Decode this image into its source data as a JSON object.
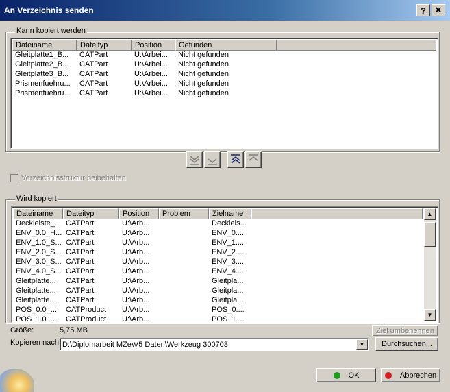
{
  "window": {
    "title": "An Verzeichnis senden",
    "help_label": "?",
    "close_label": "✕"
  },
  "copyable": {
    "legend": "Kann kopiert werden",
    "columns": [
      "Dateiname",
      "Dateityp",
      "Position",
      "Gefunden"
    ],
    "rows": [
      [
        "Gleitplatte1_B...",
        "CATPart",
        "U:\\Arbei...",
        "Nicht gefunden"
      ],
      [
        "Gleitplatte2_B...",
        "CATPart",
        "U:\\Arbei...",
        "Nicht gefunden"
      ],
      [
        "Gleitplatte3_B...",
        "CATPart",
        "U:\\Arbei...",
        "Nicht gefunden"
      ],
      [
        "Prismenfuehru...",
        "CATPart",
        "U:\\Arbei...",
        "Nicht gefunden"
      ],
      [
        "Prismenfuehru...",
        "CATPart",
        "U:\\Arbei...",
        "Nicht gefunden"
      ]
    ]
  },
  "transfer_buttons": [
    "move-all-down-icon",
    "move-down-icon",
    "move-all-up-icon",
    "move-up-icon"
  ],
  "keep_structure": {
    "label": "Verzeichnisstruktur beibehalten",
    "checked": false
  },
  "copied": {
    "legend": "Wird kopiert",
    "columns": [
      "Dateiname",
      "Dateityp",
      "Position",
      "Problem",
      "Zielname"
    ],
    "rows": [
      [
        "Deckleiste_...",
        "CATPart",
        "U:\\Arb...",
        "",
        "Deckleis..."
      ],
      [
        "ENV_0.0_H...",
        "CATPart",
        "U:\\Arb...",
        "",
        "ENV_0...."
      ],
      [
        "ENV_1.0_S...",
        "CATPart",
        "U:\\Arb...",
        "",
        "ENV_1...."
      ],
      [
        "ENV_2.0_S...",
        "CATPart",
        "U:\\Arb...",
        "",
        "ENV_2...."
      ],
      [
        "ENV_3.0_S...",
        "CATPart",
        "U:\\Arb...",
        "",
        "ENV_3...."
      ],
      [
        "ENV_4.0_S...",
        "CATPart",
        "U:\\Arb...",
        "",
        "ENV_4...."
      ],
      [
        "Gleitplatte...",
        "CATPart",
        "U:\\Arb...",
        "",
        "Gleitpla..."
      ],
      [
        "Gleitplatte...",
        "CATPart",
        "U:\\Arb...",
        "",
        "Gleitpla..."
      ],
      [
        "Gleitplatte...",
        "CATPart",
        "U:\\Arb...",
        "",
        "Gleitpla..."
      ],
      [
        "POS_0.0_...",
        "CATProduct",
        "U:\\Arb...",
        "",
        "POS_0...."
      ],
      [
        "POS_1.0_...",
        "CATProduct",
        "U:\\Arb...",
        "",
        "POS_1...."
      ]
    ]
  },
  "size": {
    "label": "Größe:",
    "value": "5,75 MB"
  },
  "rename_button": "Ziel umbenennen",
  "copy_to": {
    "label": "Kopieren nach:",
    "value": "D:\\Diplomarbeit MZe\\V5 Daten\\Werkzeug 300703"
  },
  "browse_button": "Durchsuchen...",
  "ok_button": "OK",
  "cancel_button": "Abbrechen",
  "colors": {
    "ok_dot": "#1ea01e",
    "cancel_dot": "#d42020",
    "title_start": "#0a246a",
    "title_end": "#a6caf0"
  }
}
